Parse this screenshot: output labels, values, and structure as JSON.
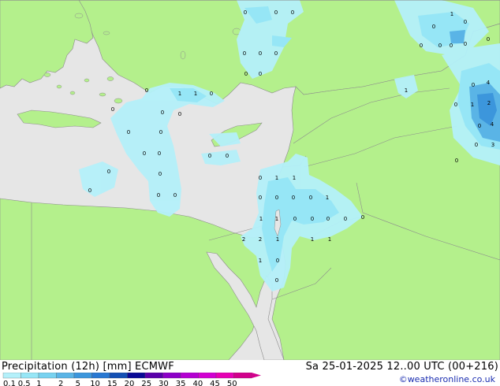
{
  "footer": {
    "title": "Precipitation (12h) [mm] ECMWF",
    "datetime": "Sa 25-01-2025 12..00 UTC (00+216)",
    "credit": "©weatheronline.co.uk"
  },
  "legend": {
    "labels": [
      "0.1",
      "0.5",
      "1",
      "2",
      "5",
      "10",
      "15",
      "20",
      "25",
      "30",
      "35",
      "40",
      "45",
      "50"
    ],
    "colors": [
      "#b4f0fa",
      "#96e6f6",
      "#78d2f0",
      "#5ab4e6",
      "#3c96dc",
      "#2878d2",
      "#1450b4",
      "#0a0a96",
      "#5a00aa",
      "#8c00c8",
      "#b400d2",
      "#d200d2",
      "#e600b4",
      "#d2008c"
    ]
  },
  "palette": {
    "sea": "#e6e6e6",
    "land": "#b4f08c",
    "border": "#8c8c8c",
    "precip_light": "#b4f0fa",
    "precip_mid": "#96e6f6",
    "precip_heavy": "#5ab4e6"
  },
  "map_labels": {
    "values": [
      "0",
      "0",
      "0",
      "0",
      "0",
      "0",
      "0",
      "0",
      "1",
      "1",
      "0",
      "0",
      "0",
      "0",
      "0",
      "0",
      "0",
      "0",
      "0",
      "0",
      "0",
      "0",
      "0",
      "0",
      "0",
      "0",
      "0",
      "1",
      "1",
      "0",
      "0",
      "0",
      "0",
      "1",
      "1",
      "1",
      "0",
      "0",
      "0",
      "0",
      "2",
      "2",
      "1",
      "1",
      "1",
      "1",
      "0",
      "0",
      "0",
      "1",
      "1",
      "4",
      "2",
      "4",
      "3",
      "0",
      "0",
      "1",
      "0",
      "0",
      "0",
      "0",
      "0",
      "0",
      "0",
      "0",
      "0",
      "0"
    ]
  }
}
